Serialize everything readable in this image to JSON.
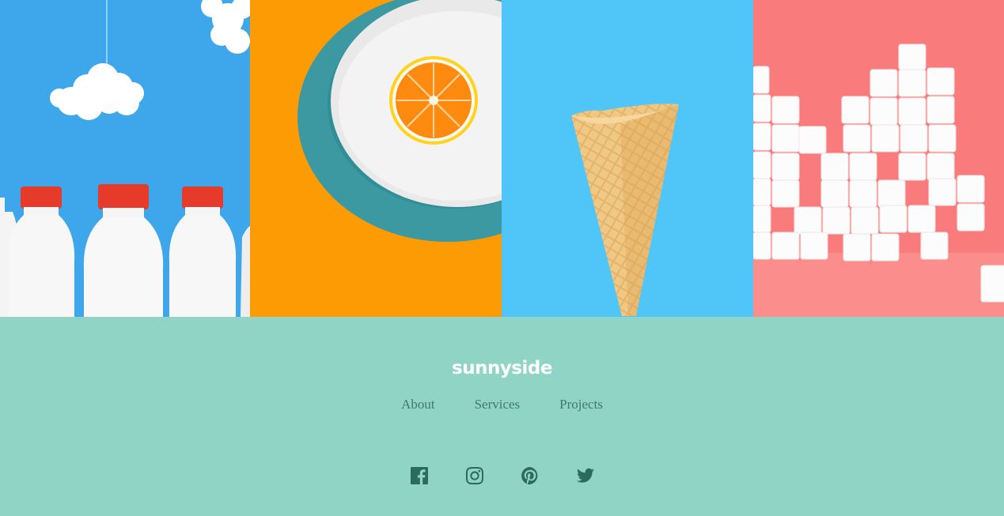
{
  "gallery": {
    "tiles": [
      {
        "subject": "milk-bottles",
        "background": "#3ea6ea"
      },
      {
        "subject": "orange-in-bowl",
        "background": "#fd9b05"
      },
      {
        "subject": "waffle-cone",
        "background": "#4fc6f7"
      },
      {
        "subject": "sugar-cubes",
        "background": "#f97b7b"
      }
    ]
  },
  "footer": {
    "background": "#90d4c5",
    "logo": "sunnyside",
    "nav": [
      {
        "label": "About"
      },
      {
        "label": "Services"
      },
      {
        "label": "Projects"
      }
    ],
    "social": [
      {
        "icon": "facebook-icon"
      },
      {
        "icon": "instagram-icon"
      },
      {
        "icon": "pinterest-icon"
      },
      {
        "icon": "twitter-icon"
      }
    ],
    "accent": "#2c6a5d"
  }
}
